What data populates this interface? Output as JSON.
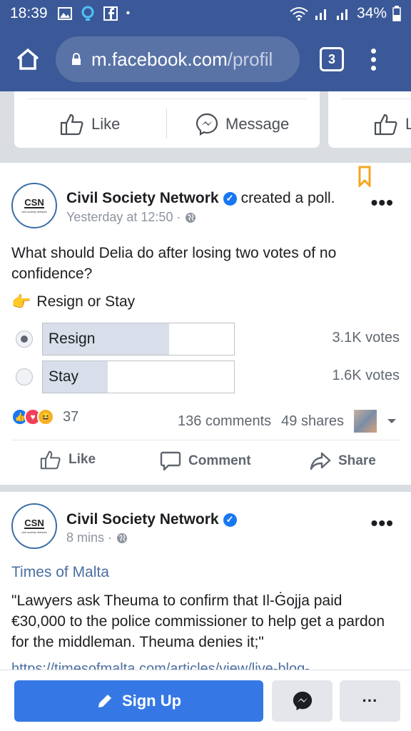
{
  "status": {
    "time": "18:39",
    "battery": "34%"
  },
  "browser": {
    "url_main": "m.facebook.com",
    "url_rest": "/profil",
    "tab_count": "3"
  },
  "profile_actions": {
    "like": "Like",
    "message": "Message",
    "like_partial": "L"
  },
  "poll_post": {
    "author": "Civil Society Network",
    "action": "created a poll.",
    "time": "Yesterday at 12:50 ·",
    "question": "What should Delia do after losing two votes of no confidence?",
    "subtitle": "Resign or Stay",
    "options": [
      {
        "label": "Resign",
        "votes": "3.1K votes",
        "fraction": 0.66,
        "selected": true
      },
      {
        "label": "Stay",
        "votes": "1.6K votes",
        "fraction": 0.34,
        "selected": false
      }
    ],
    "reaction_count": "37",
    "comments": "136 comments",
    "shares": "49 shares",
    "actions": {
      "like": "Like",
      "comment": "Comment",
      "share": "Share"
    }
  },
  "news_post": {
    "author": "Civil Society Network",
    "time": "8 mins ·",
    "source": "Times of Malta",
    "quote": "\"Lawyers ask Theuma to confirm that Il-Ġojja paid €30,000 to the police commissioner to help get a pardon for the middleman. Theuma denies it;\"",
    "link": "https://timesofmalta.com/articles/view/live-blog-"
  },
  "avatar_text": {
    "logo": "CSN",
    "tagline": "civil society network"
  },
  "bottom": {
    "signup": "Sign Up",
    "more": "···"
  },
  "colors": {
    "brand": "#3b5998",
    "accent": "#3578e5"
  }
}
